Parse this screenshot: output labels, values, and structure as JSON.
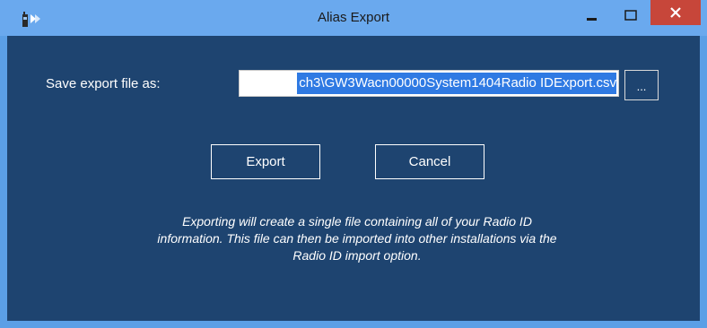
{
  "window": {
    "title": "Alias Export",
    "controls": {
      "minimize_icon": "minimize-icon",
      "maximize_icon": "maximize-icon",
      "close_icon": "close-icon"
    },
    "colors": {
      "titlebar": "#6aa9ee",
      "client": "#1e4470",
      "close_button": "#c7463a",
      "selection": "#2f7ae3"
    }
  },
  "form": {
    "save_label": "Save export file as:",
    "path_value": "ch3\\GW3Wacn00000System1404Radio IDExport.csv",
    "browse_label": "...",
    "export_label": "Export",
    "cancel_label": "Cancel"
  },
  "info": {
    "line1": "Exporting will create a single file containing all of your Radio ID",
    "line2": "information.  This file can then be imported into other installations via the",
    "line3": "Radio ID import option."
  }
}
